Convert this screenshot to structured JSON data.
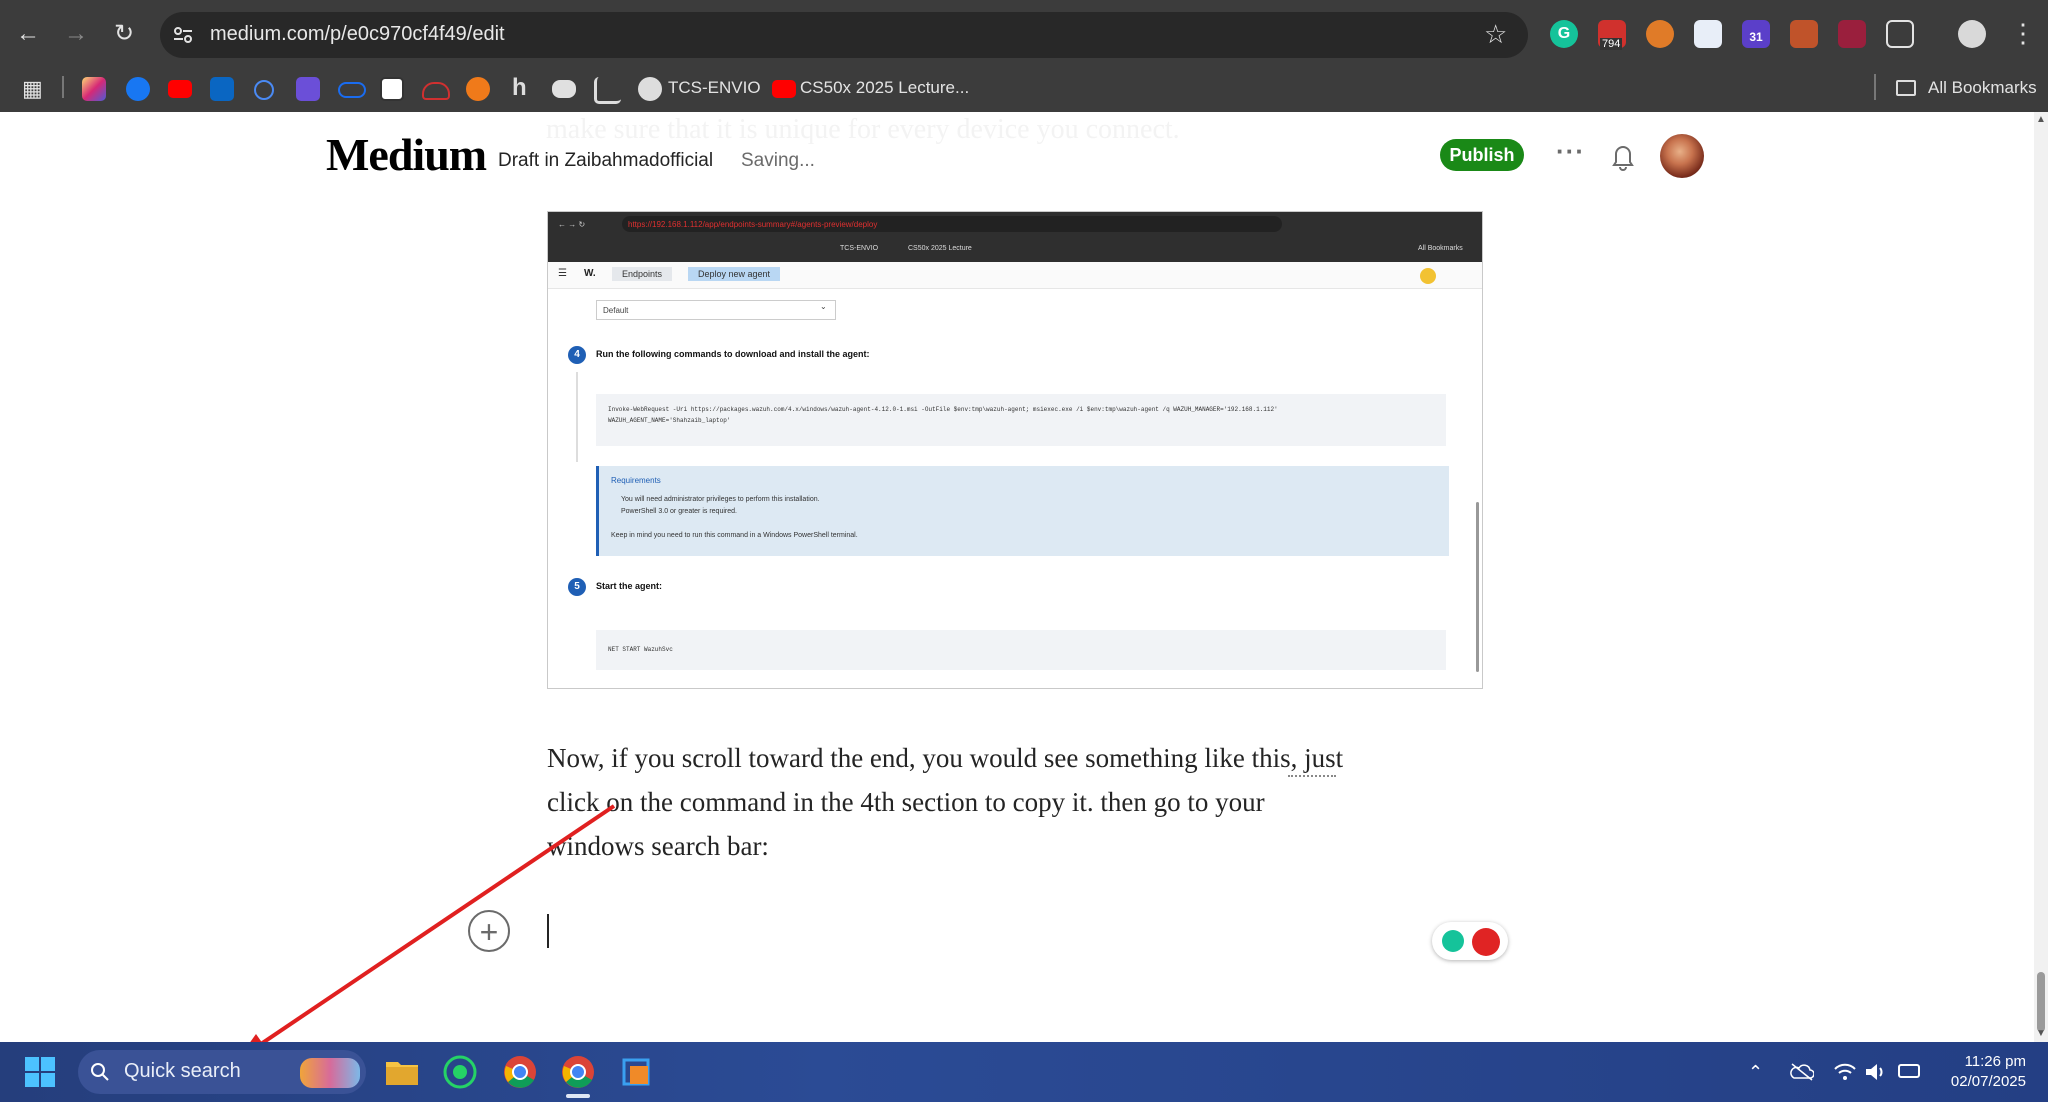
{
  "browser": {
    "url": "medium.com/p/e0c970cf4f49/edit",
    "extension_badge_count": "794",
    "calendar_ext_day": "31",
    "bookmarks": [
      {
        "label": "TCS-ENVIO"
      },
      {
        "label": "CS50x 2025 Lecture..."
      }
    ],
    "all_bookmarks_label": "All Bookmarks"
  },
  "header": {
    "logo": "Medium",
    "draft_info": "Draft in Zaibahmadofficial",
    "status": "Saving...",
    "publish_label": "Publish",
    "more_label": "···",
    "ghost_text": "make sure that it is unique for every device you connect."
  },
  "embedded_screenshot": {
    "url": "https://192.168.1.112/app/endpoints-summary#/agents-preview/deploy",
    "bookmarks": [
      "TCS-ENVIO",
      "CS50x 2025 Lecture"
    ],
    "all_bookmarks": "All Bookmarks",
    "logo": "W.",
    "tabs": [
      "Endpoints",
      "Deploy new agent"
    ],
    "select_value": "Default",
    "step4_num": "4",
    "step4_title": "Run the following commands to download and install the agent:",
    "step4_code_line1": "Invoke-WebRequest -Uri https://packages.wazuh.com/4.x/windows/wazuh-agent-4.12.0-1.msi -OutFile $env:tmp\\wazuh-agent; msiexec.exe /i $env:tmp\\wazuh-agent /q WAZUH_MANAGER='192.168.1.112'",
    "step4_code_line2": "WAZUH_AGENT_NAME='Shahzaib_laptop'",
    "requirements_title": "Requirements",
    "requirements": [
      "You will need administrator privileges to perform this installation.",
      "PowerShell 3.0 or greater is required."
    ],
    "requirements_note": "Keep in mind you need to run this command in a Windows PowerShell terminal.",
    "step5_num": "5",
    "step5_title": "Start the agent:",
    "step5_code": "NET START WazuhSvc"
  },
  "article": {
    "paragraph_line1": "Now, if you scroll toward the end, you would see something like this, just",
    "paragraph_line2": "click on the command in the 4th section to copy it. then go to your",
    "paragraph_line3": "windows search bar:",
    "plus_label": "+"
  },
  "taskbar": {
    "search_placeholder": "Quick search",
    "time": "11:26 pm",
    "date": "02/07/2025"
  },
  "colors": {
    "publish": "#1a8917",
    "taskbar": "#2b4b95",
    "annotation_arrow": "#e02020"
  }
}
